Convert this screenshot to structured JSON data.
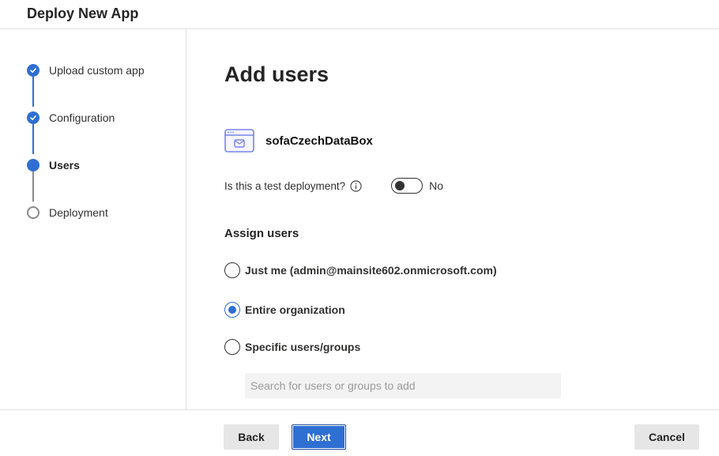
{
  "header": {
    "title": "Deploy New App"
  },
  "steps": [
    {
      "label": "Upload custom app",
      "state": "done"
    },
    {
      "label": "Configuration",
      "state": "done"
    },
    {
      "label": "Users",
      "state": "current"
    },
    {
      "label": "Deployment",
      "state": "pending"
    }
  ],
  "main": {
    "title": "Add users",
    "app_name": "sofaCzechDataBox",
    "app_icon": "app-window-mail-icon",
    "test_deployment": {
      "label": "Is this a test deployment?",
      "info_icon": "info-icon",
      "toggle_on": false,
      "toggle_text": "No"
    },
    "assign_section_title": "Assign users",
    "assign_options": [
      {
        "label": "Just me (admin@mainsite602.onmicrosoft.com)",
        "selected": false
      },
      {
        "label": "Entire organization",
        "selected": true
      },
      {
        "label": "Specific users/groups",
        "selected": false
      }
    ],
    "search": {
      "value": "",
      "placeholder": "Search for users or groups to add"
    }
  },
  "footer": {
    "back_label": "Back",
    "next_label": "Next",
    "cancel_label": "Cancel"
  },
  "colors": {
    "accent": "#2f6fd2",
    "pending": "#8a8a8a",
    "icon_purple": "#7b83eb"
  }
}
